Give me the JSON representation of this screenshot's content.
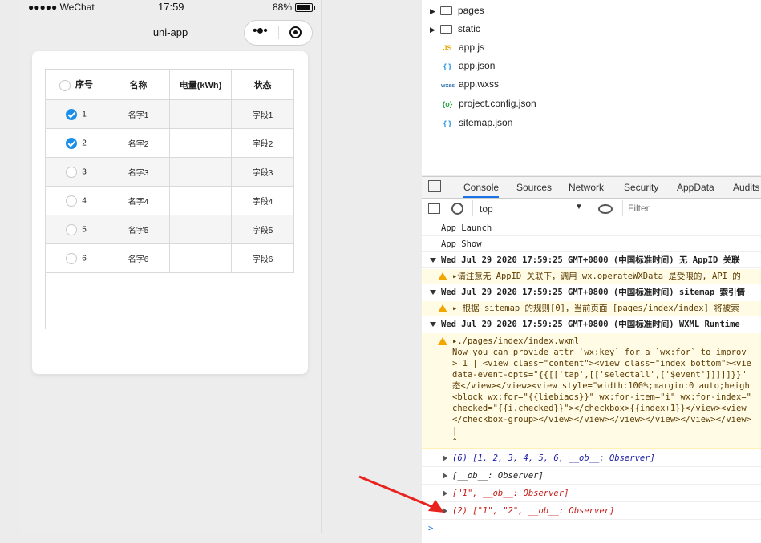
{
  "phone": {
    "status": {
      "signal": "●●●●● WeChat",
      "time": "17:59",
      "battery": "88%"
    },
    "nav_title": "uni-app",
    "table": {
      "headers": [
        "序号",
        "名称",
        "电量(kWh)",
        "状态"
      ],
      "rows": [
        {
          "num": "1",
          "name": "名字1",
          "power": "",
          "status": "字段1",
          "checked": true
        },
        {
          "num": "2",
          "name": "名字2",
          "power": "",
          "status": "字段2",
          "checked": true
        },
        {
          "num": "3",
          "name": "名字3",
          "power": "",
          "status": "字段3",
          "checked": false
        },
        {
          "num": "4",
          "name": "名字4",
          "power": "",
          "status": "字段4",
          "checked": false
        },
        {
          "num": "5",
          "name": "名字5",
          "power": "",
          "status": "字段5",
          "checked": false
        },
        {
          "num": "6",
          "name": "名字6",
          "power": "",
          "status": "字段6",
          "checked": false
        }
      ]
    }
  },
  "filetree": {
    "items": [
      {
        "label": "pages",
        "type": "folder"
      },
      {
        "label": "static",
        "type": "folder"
      },
      {
        "label": "app.js",
        "type": "js",
        "icon": "JS"
      },
      {
        "label": "app.json",
        "type": "json",
        "icon": "{ }"
      },
      {
        "label": "app.wxss",
        "type": "wxss",
        "icon": "wxss"
      },
      {
        "label": "project.config.json",
        "type": "config",
        "icon": "{o}"
      },
      {
        "label": "sitemap.json",
        "type": "json",
        "icon": "{ }"
      }
    ]
  },
  "devtools": {
    "tabs": [
      "Console",
      "Sources",
      "Network",
      "Security",
      "AppData",
      "Audits"
    ],
    "context": "top",
    "filter_placeholder": "Filter"
  },
  "console": {
    "lines": [
      "App Launch",
      "App Show",
      "Wed Jul 29 2020 17:59:25 GMT+0800 (中国标准时间) 无 AppID 关联",
      "▸请注意无 AppID 关联下，调用 wx.operateWXData 是受限的, API 的",
      "Wed Jul 29 2020 17:59:25 GMT+0800 (中国标准时间) sitemap 索引情",
      "▸ 根据 sitemap 的规则[0]，当前页面 [pages/index/index] 将被索",
      "Wed Jul 29 2020 17:59:25 GMT+0800 (中国标准时间) WXML Runtime"
    ],
    "warn_block": [
      "▸./pages/index/index.wxml",
      " Now you can provide attr `wx:key` for a `wx:for` to improv",
      "> 1 | <view class=\"content\"><view class=\"index_bottom\"><vie",
      "data-event-opts=\"{{[['tap',[['selectall',['$event']]]]]}}\"",
      "态</view></view><view style=\"width:100%;margin:0 auto;heigh",
      "<block wx:for=\"{{liebiaos}}\" wx:for-item=\"i\" wx:for-index=\"",
      "checked=\"{{i.checked}}\"></checkbox>{{index+1}}</view><view",
      "</checkbox-group></view></view></view></view></view></view>",
      "    |",
      "^"
    ],
    "outputs": [
      "(6) [1, 2, 3, 4, 5, 6, __ob__: Observer]",
      "[__ob__: Observer]",
      "[\"1\", __ob__: Observer]",
      "(2) [\"1\", \"2\", __ob__: Observer]"
    ],
    "prompt": ">"
  },
  "colors": {
    "accent": "#1a8ee8",
    "arrow": "#e8231f",
    "warn_bg": "#fffbe5"
  }
}
